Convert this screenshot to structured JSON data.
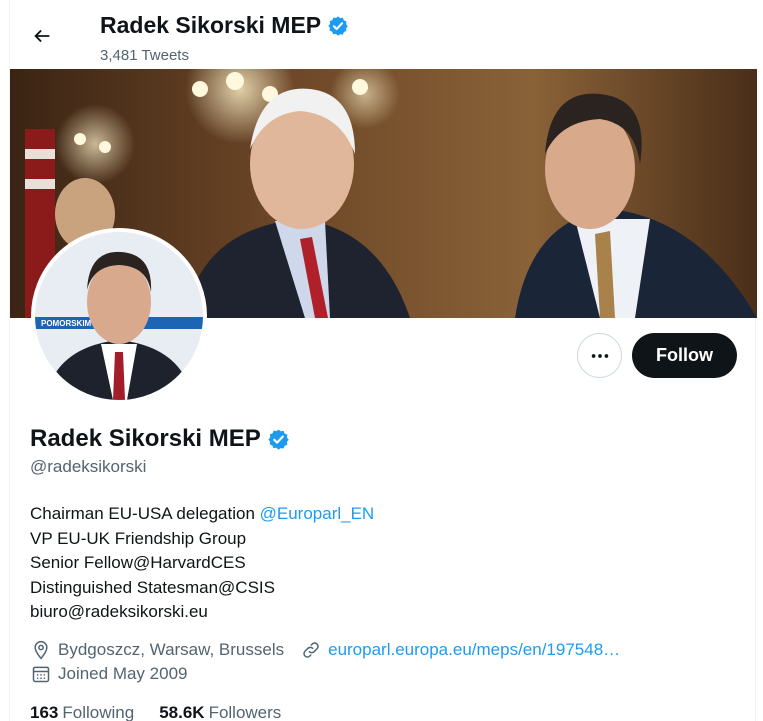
{
  "header": {
    "name": "Radek Sikorski MEP",
    "tweet_count": "3,481 Tweets"
  },
  "profile": {
    "name": "Radek Sikorski MEP",
    "handle": "@radeksikorski",
    "verified": true,
    "bio": {
      "line1_text": "Chairman EU-USA delegation ",
      "line1_mention": "@Europarl_EN",
      "line2": "VP EU-UK Friendship Group",
      "line3": "Senior Fellow@HarvardCES",
      "line4": "Distinguished Statesman@CSIS",
      "line5": "biuro@radeksikorski.eu"
    },
    "location": "Bydgoszcz, Warsaw, Brussels",
    "website": "europarl.europa.eu/meps/en/197548…",
    "joined": "Joined May 2009",
    "following_count": "163",
    "following_label": "Following",
    "followers_count": "58.6K",
    "followers_label": "Followers"
  },
  "actions": {
    "follow_label": "Follow"
  },
  "avatar_badge_text": "POMORSKIM",
  "colors": {
    "accent": "#1d9bf0",
    "text": "#0f1419",
    "secondary": "#536471",
    "follow_bg": "#0f1419"
  },
  "icons": [
    "back-arrow-icon",
    "verified-badge-icon",
    "more-dots-icon",
    "location-pin-icon",
    "link-icon",
    "calendar-icon"
  ]
}
